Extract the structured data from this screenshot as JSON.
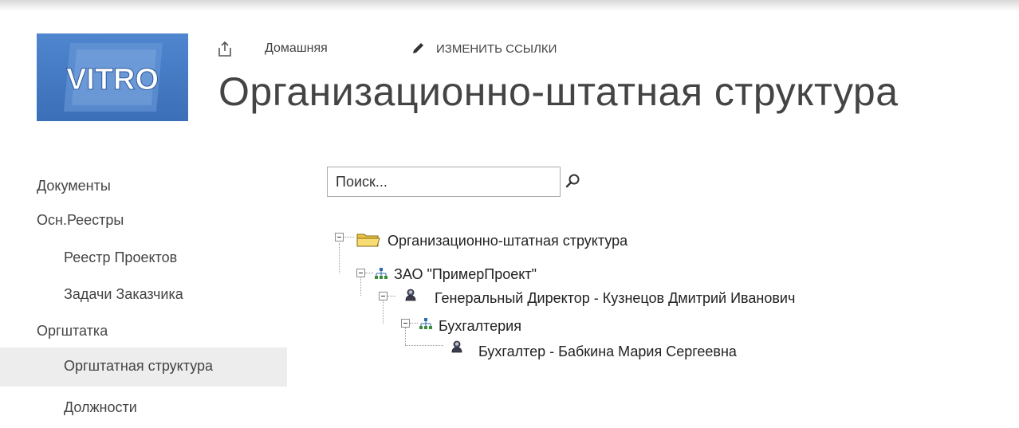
{
  "logo": {
    "text": "VITRO"
  },
  "topnav": {
    "home_label": "Домашняя",
    "edit_links_label": "ИЗМЕНИТЬ ССЫЛКИ"
  },
  "page": {
    "title": "Организационно-штатная структура"
  },
  "quicklaunch": {
    "items": [
      {
        "label": "Документы",
        "level": 1,
        "selected": false
      },
      {
        "label": "Осн.Реестры",
        "level": 1,
        "selected": false
      },
      {
        "label": "Реестр Проектов",
        "level": 2,
        "selected": false
      },
      {
        "label": "Задачи Заказчика",
        "level": 2,
        "selected": false
      },
      {
        "label": "Оргштатка",
        "level": 1,
        "selected": false
      },
      {
        "label": "Оргштатная структура",
        "level": 2,
        "selected": true
      },
      {
        "label": "Должности",
        "level": 2,
        "selected": false
      }
    ]
  },
  "search": {
    "value": "Поиск..."
  },
  "tree": {
    "nodes": [
      {
        "label": "Организационно-штатная структура",
        "icon": "folder-icon",
        "depth": 0,
        "expanded": true
      },
      {
        "label": "ЗАО \"ПримерПроект\"",
        "icon": "org-chart-icon",
        "depth": 1,
        "expanded": true
      },
      {
        "label": "Генеральный Директор - Кузнецов Дмитрий Иванович",
        "icon": "person-icon",
        "depth": 2,
        "expanded": true
      },
      {
        "label": "Бухгалтерия",
        "icon": "org-chart-icon",
        "depth": 3,
        "expanded": true
      },
      {
        "label": "Бухгалтер - Бабкина Мария Сергеевна",
        "icon": "person-icon",
        "depth": 4,
        "expanded": false
      }
    ]
  },
  "colors": {
    "logo_bg": "#4a7fc8",
    "selected_bg": "#ededed",
    "text": "#444444"
  }
}
